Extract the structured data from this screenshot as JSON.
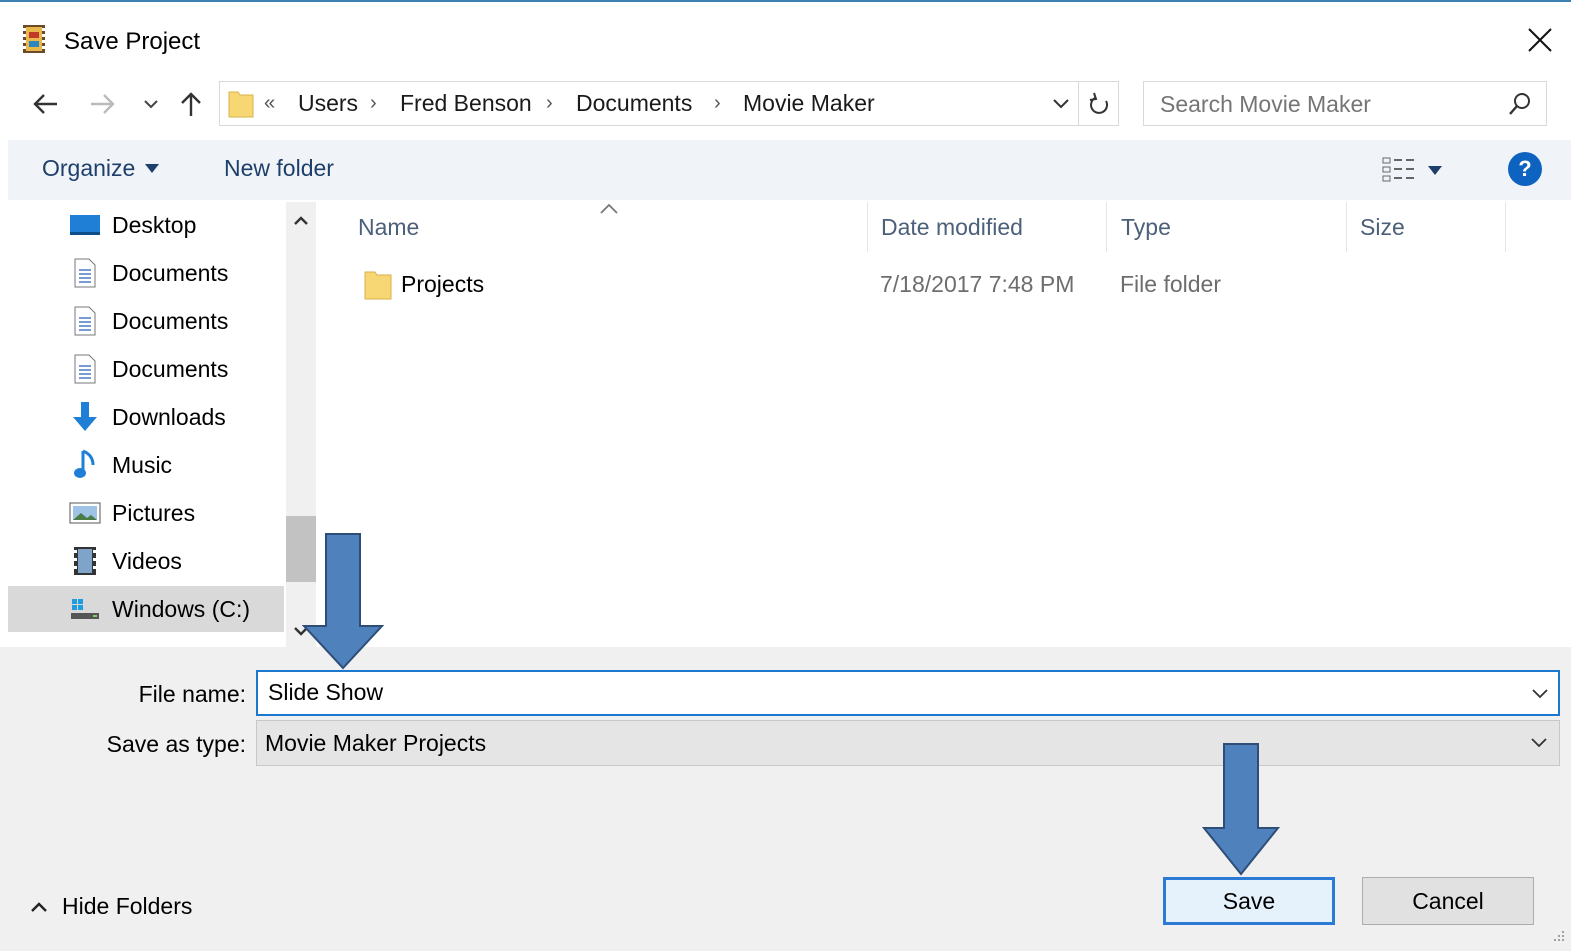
{
  "window": {
    "title": "Save Project"
  },
  "address": {
    "overflow": "«",
    "crumbs": [
      "Users",
      "Fred Benson",
      "Documents",
      "Movie Maker"
    ]
  },
  "search": {
    "placeholder": "Search Movie Maker"
  },
  "toolbar": {
    "organize": "Organize",
    "new_folder": "New folder",
    "help": "?"
  },
  "nav": {
    "items": [
      {
        "label": "Desktop",
        "icon": "desktop-icon"
      },
      {
        "label": "Documents",
        "icon": "document-icon"
      },
      {
        "label": "Documents",
        "icon": "document-icon"
      },
      {
        "label": "Documents",
        "icon": "document-icon"
      },
      {
        "label": "Downloads",
        "icon": "download-icon"
      },
      {
        "label": "Music",
        "icon": "music-icon"
      },
      {
        "label": "Pictures",
        "icon": "pictures-icon"
      },
      {
        "label": "Videos",
        "icon": "videos-icon"
      },
      {
        "label": "Windows (C:)",
        "icon": "drive-icon",
        "selected": true
      }
    ]
  },
  "filelist": {
    "columns": [
      "Name",
      "Date modified",
      "Type",
      "Size"
    ],
    "rows": [
      {
        "name": "Projects",
        "date": "7/18/2017 7:48 PM",
        "type": "File folder",
        "size": ""
      }
    ]
  },
  "form": {
    "file_name_label": "File name:",
    "file_name_value": "Slide Show",
    "save_as_type_label": "Save as type:",
    "save_as_type_value": "Movie Maker Projects"
  },
  "footer": {
    "hide_folders": "Hide Folders",
    "save": "Save",
    "cancel": "Cancel"
  },
  "colors": {
    "accent": "#1b78cf",
    "annotation_arrow": "#4f81bd",
    "help": "#0e62c0"
  }
}
